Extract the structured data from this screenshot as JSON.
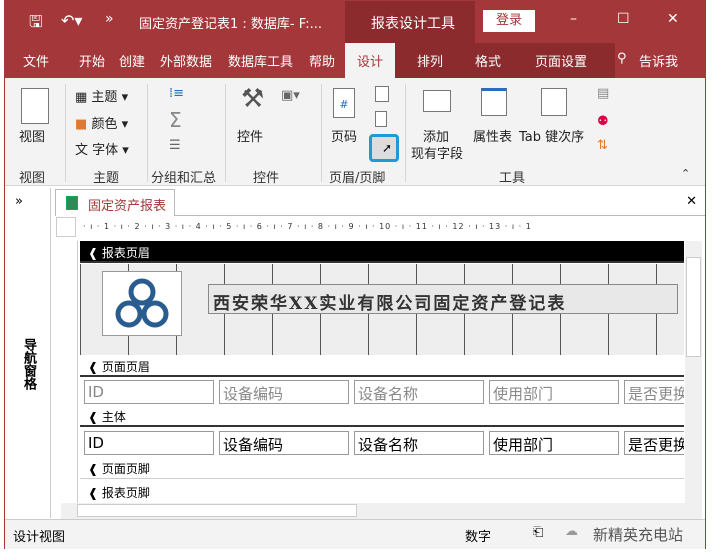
{
  "titlebar": {
    "title": "固定资产登记表1 : 数据库- F:...",
    "context": "报表设计工具",
    "login": "登录",
    "minimize": "–",
    "maximize": "☐",
    "close": "✕",
    "more": "»"
  },
  "tabs": [
    "文件",
    "开始",
    "创建",
    "外部数据",
    "数据库工具",
    "帮助",
    "设计",
    "排列",
    "格式",
    "页面设置"
  ],
  "tell_me": "告诉我",
  "ribbon": {
    "view": {
      "label": "视图",
      "group": "视图"
    },
    "theme": {
      "items": [
        "主题",
        "颜色",
        "字体"
      ],
      "group": "主题"
    },
    "grouping": {
      "group": "分组和汇总"
    },
    "controls": {
      "label": "控件",
      "group": "控件"
    },
    "headerfooter": {
      "pagenum": "页码",
      "group": "页眉/页脚"
    },
    "tools": {
      "add_fields": "添加",
      "add_fields2": "现有字段",
      "property": "属性表",
      "taborder": "Tab 键次序",
      "group": "工具"
    }
  },
  "nav": {
    "label": "导航窗格",
    "toggle": "»"
  },
  "doc": {
    "tab": "固定资产报表",
    "close": "✕",
    "ruler": "· ı · 1 · ı · 2 · ı · 3 · ı · 4 · ı · 5 · ı · 6 · ı · 7 · ı · 8 · ı · 9 · ı · 10 · ı · 11 · ı · 12 · ı · 13 · ı · 1"
  },
  "sections": {
    "report_header": "报表页眉",
    "page_header": "页面页眉",
    "detail": "主体",
    "page_footer": "页面页脚",
    "report_footer": "报表页脚"
  },
  "report_title": "西安荣华XX实业有限公司固定资产登记表",
  "fields": [
    "ID",
    "设备编码",
    "设备名称",
    "使用部门",
    "是否更换"
  ],
  "status": {
    "left": "设计视图",
    "num": "数字",
    "watermark": "新精英充电站"
  },
  "colors": {
    "accent": "#a4373a",
    "highlight": "#1e9bd7"
  }
}
